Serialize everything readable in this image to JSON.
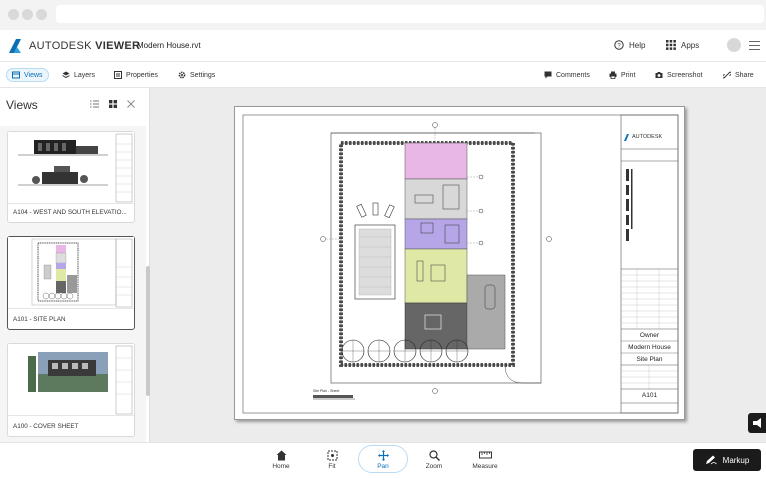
{
  "app": {
    "brand_name": "AUTODESK",
    "brand_product": "VIEWER",
    "file_name": "Modern House.rvt",
    "help_label": "Help",
    "apps_label": "Apps"
  },
  "toolbar": {
    "left": [
      {
        "label": "Views",
        "icon": "views-icon",
        "active": true
      },
      {
        "label": "Layers",
        "icon": "layers-icon"
      },
      {
        "label": "Properties",
        "icon": "properties-icon"
      },
      {
        "label": "Settings",
        "icon": "settings-icon"
      }
    ],
    "right": [
      {
        "label": "Comments",
        "icon": "comments-icon"
      },
      {
        "label": "Print",
        "icon": "print-icon"
      },
      {
        "label": "Screenshot",
        "icon": "camera-icon"
      },
      {
        "label": "Share",
        "icon": "share-icon"
      }
    ]
  },
  "sidebar": {
    "title": "Views",
    "thumbnails": [
      {
        "label": "A104 - WEST AND SOUTH ELEVATIO..."
      },
      {
        "label": "A101 - SITE PLAN",
        "selected": true
      },
      {
        "label": "A100 - COVER SHEET"
      }
    ]
  },
  "sheet": {
    "logo_text": "AUTODESK",
    "owner": "Owner",
    "project": "Modern House",
    "sheet_name": "Site Plan",
    "sheet_number": "A101",
    "view_title": "Site Plan - Sheet"
  },
  "bottom_tools": [
    {
      "label": "Home",
      "icon": "home-icon"
    },
    {
      "label": "Fit",
      "icon": "fit-icon"
    },
    {
      "label": "Pan",
      "icon": "pan-icon",
      "active": true
    },
    {
      "label": "Zoom",
      "icon": "zoom-icon"
    },
    {
      "label": "Measure",
      "icon": "measure-icon"
    }
  ],
  "markup_label": "Markup",
  "colors": {
    "accent": "#0a6fb5",
    "room_pink": "#e8b7e6",
    "room_green": "#e0e8a6",
    "room_purple": "#b6a6e8",
    "dark_button": "#1b1b1b"
  }
}
